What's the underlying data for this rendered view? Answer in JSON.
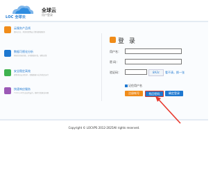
{
  "header": {
    "logo_text": "LOC 全球云",
    "brand": "全球云",
    "subtitle": "用户登录"
  },
  "features": [
    {
      "title": "云服务产品线",
      "desc": "面向企业、开发者提供云计算和数据服务",
      "icon": "cloud-icon",
      "color": "#f08c1a"
    },
    {
      "title": "数据可视化分析",
      "desc": "帮助您快速挖掘、分析数据价值，辅助决策",
      "icon": "chart-icon",
      "color": "#1e78d0"
    },
    {
      "title": "安全稳定高效",
      "desc": "提供多层安全防护，保障数据与业务稳定运行",
      "icon": "shield-icon",
      "color": "#3fb34f"
    },
    {
      "title": "快速响应服务",
      "desc": "7×24 小时专业技术支持，随时为您解决问题",
      "icon": "support-icon",
      "color": "#9b59b6"
    }
  ],
  "login": {
    "title": "登 录",
    "username_label": "用户名：",
    "password_label": "密 码：",
    "captcha_label": "验证码：",
    "captcha_text": "8A3c",
    "refresh_text": "看不清，换一张",
    "remember_label": "记住用户名",
    "register_button": "注册帐号",
    "forgot_button": "找回密码",
    "login_button": "确定登录"
  },
  "footer": {
    "copyright": "Copyright © LOCVPS 2012-2025All rights reserved."
  }
}
